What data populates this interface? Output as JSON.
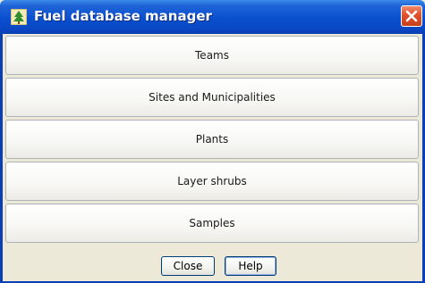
{
  "window": {
    "title": "Fuel database manager",
    "app_icon": "tree-icon",
    "close_icon": "close-icon",
    "titlebar_color": "#0a4fcf",
    "close_color": "#e0502a"
  },
  "menu": {
    "items": [
      {
        "label": "Teams"
      },
      {
        "label": "Sites and Municipalities"
      },
      {
        "label": "Plants"
      },
      {
        "label": "Layer shrubs"
      },
      {
        "label": "Samples"
      }
    ]
  },
  "footer": {
    "close_label": "Close",
    "help_label": "Help"
  }
}
